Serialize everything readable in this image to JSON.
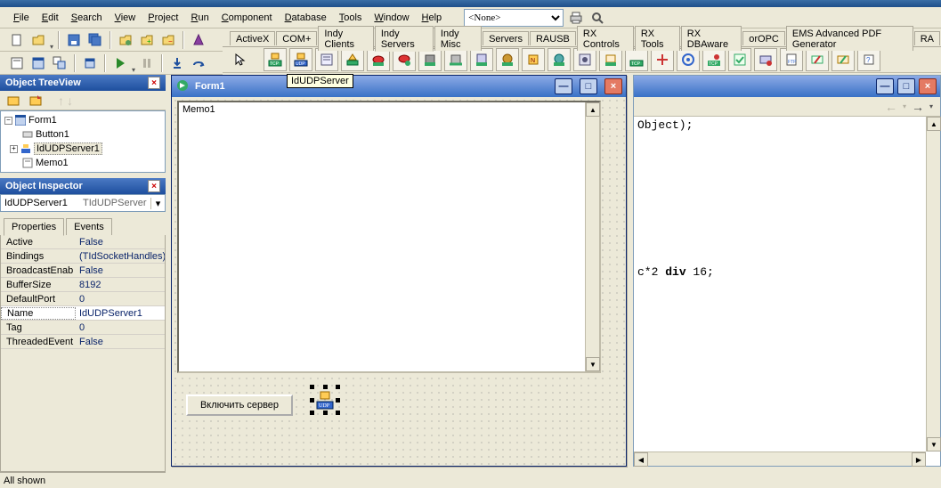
{
  "menu": {
    "items": [
      "File",
      "Edit",
      "Search",
      "View",
      "Project",
      "Run",
      "Component",
      "Database",
      "Tools",
      "Window",
      "Help"
    ],
    "combo_value": "<None>"
  },
  "palette_tabs": [
    "ActiveX",
    "COM+",
    "Indy Clients",
    "Indy Servers",
    "Indy Misc",
    "Servers",
    "RAUSB",
    "RX Controls",
    "RX Tools",
    "RX DBAware",
    "orOPC",
    "EMS Advanced PDF Generator",
    "RA"
  ],
  "palette_active_index": 3,
  "tooltip": "IdUDPServer",
  "tree_panel": {
    "title": "Object TreeView",
    "root": "Form1",
    "children": [
      "Button1",
      "IdUDPServer1",
      "Memo1"
    ],
    "selected": "IdUDPServer1"
  },
  "inspector": {
    "title": "Object Inspector",
    "combo_name": "IdUDPServer1",
    "combo_type": "TIdUDPServer",
    "tabs": [
      "Properties",
      "Events"
    ],
    "active_tab": 0,
    "rows": [
      {
        "name": "Active",
        "value": "False"
      },
      {
        "name": "Bindings",
        "value": "(TIdSocketHandles)"
      },
      {
        "name": "BroadcastEnab",
        "value": "False"
      },
      {
        "name": "BufferSize",
        "value": "8192"
      },
      {
        "name": "DefaultPort",
        "value": "0"
      },
      {
        "name": "Name",
        "value": "IdUDPServer1"
      },
      {
        "name": "Tag",
        "value": "0"
      },
      {
        "name": "ThreadedEvent",
        "value": "False"
      }
    ],
    "selected_row": 5
  },
  "status": "All shown",
  "form": {
    "title": "Form1",
    "memo_text": "Memo1",
    "button_label": "Включить сервер"
  },
  "code": {
    "line1": "Object);",
    "line2_prefix": "c*2 ",
    "line2_kw": "div",
    "line2_suffix": " 16;"
  }
}
